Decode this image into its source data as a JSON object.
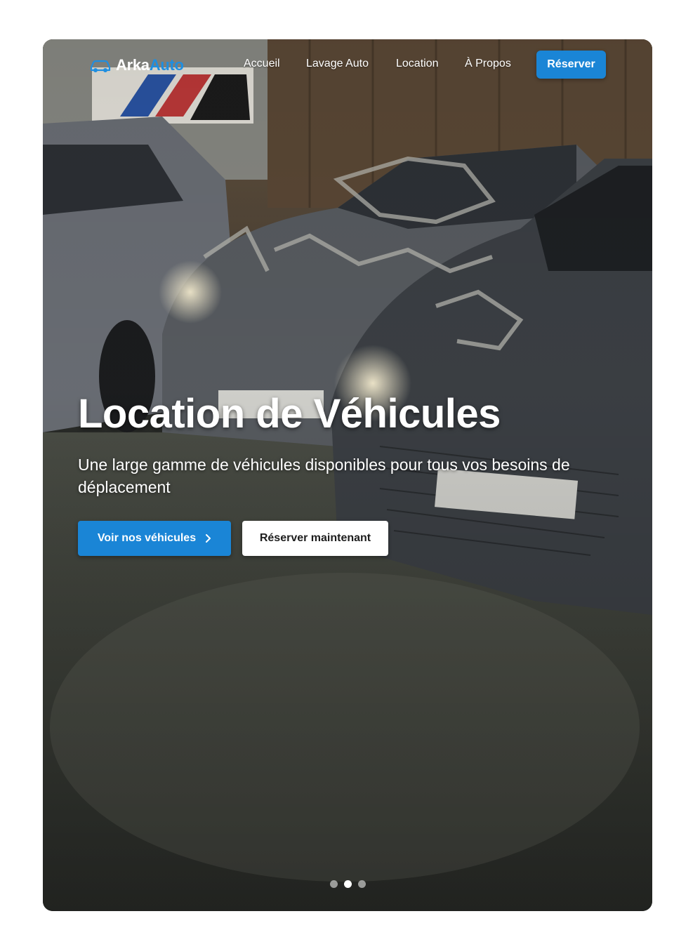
{
  "brand": {
    "name_part1": "Arka",
    "name_part2": "Auto",
    "accent_color": "#1a85d6"
  },
  "nav": {
    "links": [
      "Accueil",
      "Lavage Auto",
      "Location",
      "À Propos"
    ],
    "cta_label": "Réserver"
  },
  "hero": {
    "title": "Location de Véhicules",
    "subtitle": "Une large gamme de véhicules disponibles pour tous vos besoins de déplacement",
    "primary_button": "Voir nos véhicules",
    "secondary_button": "Réserver maintenant",
    "background_icon": "garage-cars-photo",
    "slides": {
      "count": 3,
      "active_index": 1
    }
  }
}
